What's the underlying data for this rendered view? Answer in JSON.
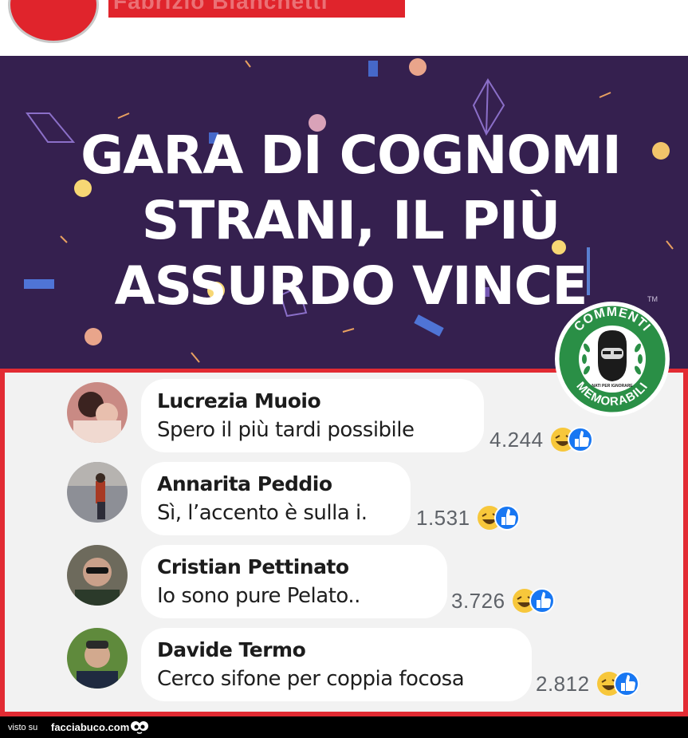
{
  "header": {
    "avatar_color": "#e0242c",
    "name_redacted": "Fabrizio Bianchetti"
  },
  "banner": {
    "title_lines": [
      "GARA DI COGNOMI",
      "STRANI, IL PIÙ",
      "ASSURDO VINCE"
    ],
    "background": "#35204f",
    "tm": "TM"
  },
  "badge": {
    "text_top": "COMMENTI",
    "text_bottom": "MEMORABILI",
    "text_small": "NATI PER IGNORARE",
    "color": "#2a8f46"
  },
  "comments": [
    {
      "author": "Lucrezia Muoio",
      "text": "Spero il più tardi possibile",
      "count": "4.244",
      "reactions": [
        "haha-icon",
        "like-icon"
      ]
    },
    {
      "author": "Annarita Peddio",
      "text": "Sì, l’accento è sulla i.",
      "count": "1.531",
      "reactions": [
        "haha-icon",
        "like-icon"
      ]
    },
    {
      "author": "Cristian Pettinato",
      "text": "Io sono pure Pelato..",
      "count": "3.726",
      "reactions": [
        "haha-icon",
        "like-icon"
      ]
    },
    {
      "author": "Davide Termo",
      "text": "Cerco sifone per coppia focosa",
      "count": "2.812",
      "reactions": [
        "haha-icon",
        "like-icon"
      ]
    }
  ],
  "footer": {
    "visto_su": "visto su",
    "site": "facciabuco.com"
  },
  "colors": {
    "frame": "#e22b33",
    "like": "#1877f2",
    "haha": "#f7c73b"
  }
}
